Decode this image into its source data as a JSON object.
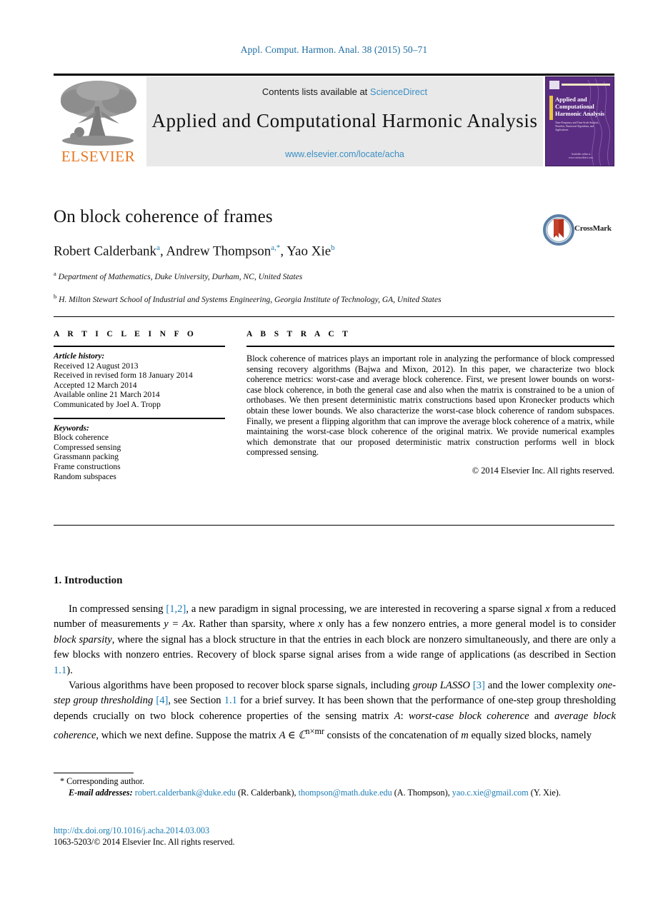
{
  "running_head": "Appl. Comput. Harmon. Anal. 38 (2015) 50–71",
  "banner": {
    "contents_prefix": "Contents lists available at ",
    "sciencedirect": "ScienceDirect",
    "journal_title": "Applied and Computational Harmonic Analysis",
    "journal_url": "www.elsevier.com/locate/acha",
    "publisher": "ELSEVIER",
    "cover": {
      "title": "Applied and Computational Harmonic Analysis",
      "subtitle": "Time-Frequency and Time-Scale Analysis, Wavelets, Numerical Algorithms, and Applications",
      "footer": "Available online at www.sciencedirect.com"
    }
  },
  "article": {
    "title": "On block coherence of frames",
    "authors": [
      {
        "name": "Robert Calderbank",
        "marks": "a"
      },
      {
        "name": "Andrew Thompson",
        "marks": "a,*"
      },
      {
        "name": "Yao Xie",
        "marks": "b"
      }
    ],
    "affiliations": [
      {
        "mark": "a",
        "text": "Department of Mathematics, Duke University, Durham, NC, United States"
      },
      {
        "mark": "b",
        "text": "H. Milton Stewart School of Industrial and Systems Engineering, Georgia Institute of Technology, GA, United States"
      }
    ],
    "crossmark_label": "CrossMark"
  },
  "info": {
    "heading": "A R T I C L E   I N F O",
    "history_label": "Article history:",
    "history": [
      "Received 12 August 2013",
      "Received in revised form 18 January 2014",
      "Accepted 12 March 2014",
      "Available online 21 March 2014",
      "Communicated by Joel A. Tropp"
    ],
    "keywords_label": "Keywords:",
    "keywords": [
      "Block coherence",
      "Compressed sensing",
      "Grassmann packing",
      "Frame constructions",
      "Random subspaces"
    ]
  },
  "abstract": {
    "heading": "A B S T R A C T",
    "text": "Block coherence of matrices plays an important role in analyzing the performance of block compressed sensing recovery algorithms (Bajwa and Mixon, 2012). In this paper, we characterize two block coherence metrics: worst-case and average block coherence. First, we present lower bounds on worst-case block coherence, in both the general case and also when the matrix is constrained to be a union of orthobases. We then present deterministic matrix constructions based upon Kronecker products which obtain these lower bounds. We also characterize the worst-case block coherence of random subspaces. Finally, we present a flipping algorithm that can improve the average block coherence of a matrix, while maintaining the worst-case block coherence of the original matrix. We provide numerical examples which demonstrate that our proposed deterministic matrix construction performs well in block compressed sensing.",
    "copyright": "© 2014 Elsevier Inc. All rights reserved."
  },
  "body": {
    "section_title": "1. Introduction",
    "para1_a": "In compressed sensing ",
    "para1_ref": "[1,2]",
    "para1_b": ", a new paradigm in signal processing, we are interested in recovering a sparse signal ",
    "para1_x1": "x",
    "para1_c": " from a reduced number of measurements ",
    "para1_math": "y = Ax",
    "para1_d": ". Rather than sparsity, where ",
    "para1_x2": "x",
    "para1_e": " only has a few nonzero entries, a more general model is to consider ",
    "para1_em": "block sparsity",
    "para1_f": ", where the signal has a block structure in that the entries in each block are nonzero simultaneously, and there are only a few blocks with nonzero entries. Recovery of block sparse signal arises from a wide range of applications (as described in Section ",
    "para1_sec": "1.1",
    "para1_g": ").",
    "para2_a": "Various algorithms have been proposed to recover block sparse signals, including ",
    "para2_em1": "group LASSO",
    "para2_ref1": "[3]",
    "para2_b": " and the lower complexity ",
    "para2_em2": "one-step group thresholding",
    "para2_ref2": "[4]",
    "para2_c": ", see Section ",
    "para2_sec": "1.1",
    "para2_d": " for a brief survey. It has been shown that the performance of one-step group thresholding depends crucially on two block coherence properties of the sensing matrix ",
    "para2_A": "A",
    "para2_e": ": ",
    "para2_em3": "worst-case block coherence",
    "para2_f": " and ",
    "para2_em4": "average block coherence",
    "para2_g": ", which we next define. Suppose the matrix ",
    "para2_math": "A ∈ ℂ",
    "para2_math_sup": "n×mr",
    "para2_h": " consists of the concatenation of ",
    "para2_m": "m",
    "para2_i": " equally sized blocks, namely"
  },
  "footer": {
    "corresponding": "* Corresponding author.",
    "email_label": "E-mail addresses:",
    "emails": [
      {
        "address": "robert.calderbank@duke.edu",
        "owner": "(R. Calderbank)"
      },
      {
        "address": "thompson@math.duke.edu",
        "owner": "(A. Thompson)"
      },
      {
        "address": "yao.c.xie@gmail.com",
        "owner": "(Y. Xie)"
      }
    ],
    "doi": "http://dx.doi.org/10.1016/j.acha.2014.03.003",
    "issn": "1063-5203/© 2014 Elsevier Inc. All rights reserved."
  },
  "colors": {
    "link": "#1a7cb5",
    "sciencedirect": "#3a8fc4",
    "elsevier_orange": "#e87722",
    "cover_purple": "#5b2d82"
  }
}
